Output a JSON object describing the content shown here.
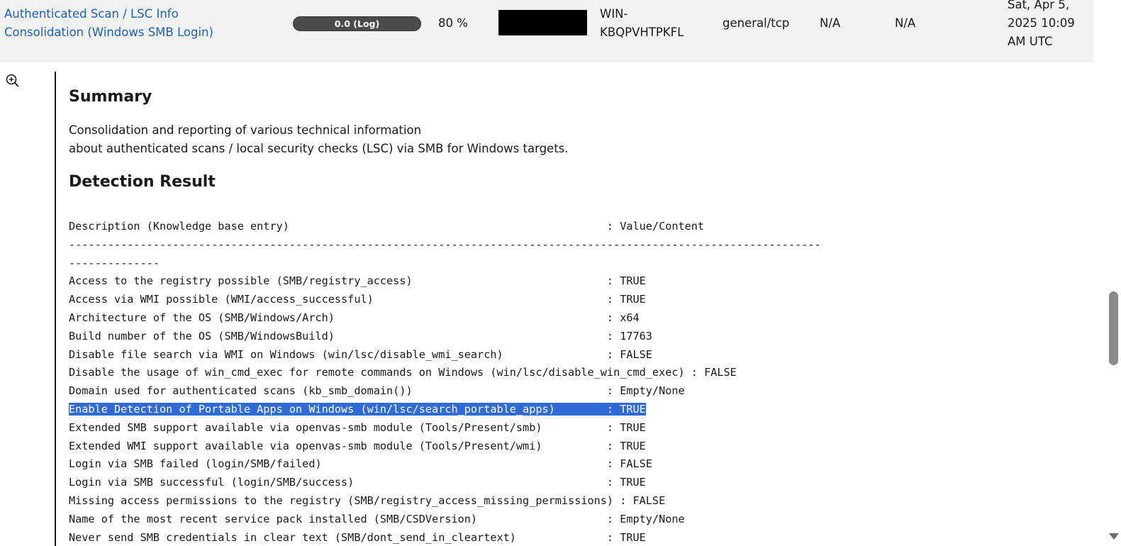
{
  "result": {
    "vt_name_line1": "Authenticated Scan / LSC Info",
    "vt_name_line2": "Consolidation (Windows SMB Login)",
    "severity": "0.0 (Log)",
    "qod": "80 %",
    "hostname_line1": "WIN-",
    "hostname_line2": "KBQPVHTPKFL",
    "location": "general/tcp",
    "epss_score": "N/A",
    "epss_percentile": "N/A",
    "created_line1": "Sat, Apr 5,",
    "created_line2": "2025 10:09",
    "created_line3": "AM UTC"
  },
  "details": {
    "summary_heading": "Summary",
    "summary_line1": "Consolidation and reporting of various technical information",
    "summary_line2": "about authenticated scans / local security checks (LSC) via SMB for Windows targets.",
    "detection_heading": "Detection Result"
  },
  "kb_table": {
    "header": "Description (Knowledge base entry)                                                 : Value/Content",
    "separator1": "--------------------------------------------------------------------------------------------------------------------",
    "separator2": "--------------",
    "rows": [
      "Access to the registry possible (SMB/registry_access)                              : TRUE",
      "Access via WMI possible (WMI/access_successful)                                    : TRUE",
      "Architecture of the OS (SMB/Windows/Arch)                                          : x64",
      "Build number of the OS (SMB/WindowsBuild)                                          : 17763",
      "Disable file search via WMI on Windows (win/lsc/disable_wmi_search)                : FALSE",
      "Disable the usage of win_cmd_exec for remote commands on Windows (win/lsc/disable_win_cmd_exec) : FALSE",
      "Domain used for authenticated scans (kb_smb_domain())                              : Empty/None",
      "Enable Detection of Portable Apps on Windows (win/lsc/search_portable_apps)        : TRUE",
      "Extended SMB support available via openvas-smb module (Tools/Present/smb)          : TRUE",
      "Extended WMI support available via openvas-smb module (Tools/Present/wmi)          : TRUE",
      "Login via SMB failed (login/SMB/failed)                                            : FALSE",
      "Login via SMB successful (login/SMB/success)                                       : TRUE",
      "Missing access permissions to the registry (SMB/registry_access_missing_permissions) : FALSE",
      "Name of the most recent service pack installed (SMB/CSDVersion)                    : Empty/None",
      "Never send SMB credentials in clear text (SMB/dont_send_in_cleartext)              : TRUE"
    ]
  }
}
